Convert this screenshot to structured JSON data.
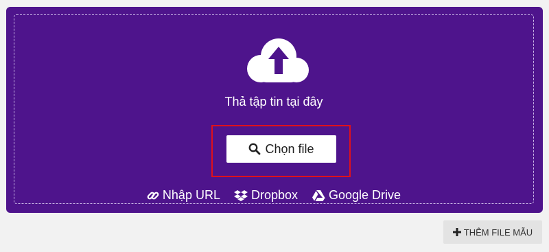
{
  "upload": {
    "drop_text": "Thả tập tin tại đây",
    "choose_label": "Chọn file",
    "sources": [
      {
        "label": "Nhập URL",
        "icon": "link-icon"
      },
      {
        "label": "Dropbox",
        "icon": "dropbox-icon"
      },
      {
        "label": "Google Drive",
        "icon": "google-drive-icon"
      }
    ]
  },
  "footer": {
    "sample_label": "THÊM FILE MẪU"
  },
  "colors": {
    "panel_bg": "#4e148c",
    "highlight": "#e0101a",
    "page_bg": "#f2f2f2"
  }
}
